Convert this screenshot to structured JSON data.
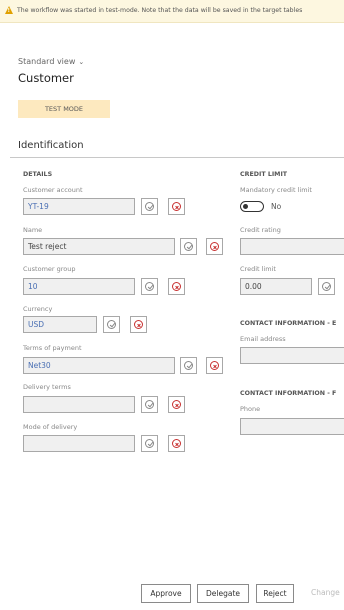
{
  "banner": {
    "message": "The workflow was started in test-mode. Note that the data will be saved in the target tables"
  },
  "header": {
    "view": "Standard view",
    "entity": "Customer",
    "test_mode": "TEST MODE"
  },
  "section": {
    "title": "Identification"
  },
  "details": {
    "title": "DETAILS",
    "customer_account": {
      "label": "Customer account",
      "value": "YT-19"
    },
    "name": {
      "label": "Name",
      "value": "Test reject"
    },
    "customer_group": {
      "label": "Customer group",
      "value": "10"
    },
    "currency": {
      "label": "Currency",
      "value": "USD"
    },
    "terms_of_payment": {
      "label": "Terms of payment",
      "value": "Net30"
    },
    "delivery_terms": {
      "label": "Delivery terms",
      "value": ""
    },
    "mode_of_delivery": {
      "label": "Mode of delivery",
      "value": ""
    }
  },
  "credit": {
    "title": "CREDIT LIMIT",
    "mandatory": {
      "label": "Mandatory credit limit",
      "state": "No"
    },
    "rating": {
      "label": "Credit rating",
      "value": ""
    },
    "limit": {
      "label": "Credit limit",
      "value": "0.00"
    }
  },
  "contact_email": {
    "title": "CONTACT INFORMATION - E",
    "label": "Email address",
    "value": ""
  },
  "contact_phone": {
    "title": "CONTACT INFORMATION - F",
    "label": "Phone",
    "value": ""
  },
  "actions": {
    "approve": "Approve",
    "delegate": "Delegate",
    "reject": "Reject",
    "change": "Change"
  },
  "colors": {
    "banner_bg": "#fdf7e0",
    "test_mode_bg": "#fde9bf",
    "value_blue": "#4a6fb3",
    "reject_red": "#c83232"
  }
}
